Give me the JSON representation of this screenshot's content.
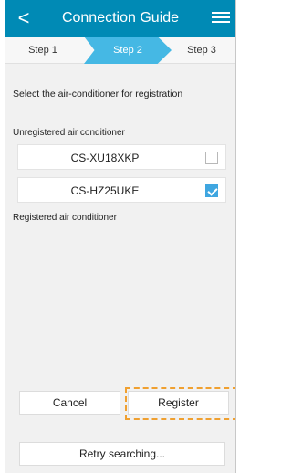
{
  "header": {
    "back_icon": "<",
    "title": "Connection Guide",
    "menu_icon": "hamburger-menu"
  },
  "steps": {
    "step1": "Step 1",
    "step2": "Step 2",
    "step3": "Step 3",
    "active": "Step 2",
    "active_color": "#45b8e4"
  },
  "instruction": "Select the air-conditioner for registration",
  "unregistered": {
    "label": "Unregistered air conditioner",
    "items": [
      {
        "name": "CS-XU18XKP",
        "checked": false
      },
      {
        "name": "CS-HZ25UKE",
        "checked": true
      }
    ]
  },
  "registered": {
    "label": "Registered air conditioner",
    "items": []
  },
  "buttons": {
    "cancel": "Cancel",
    "register": "Register",
    "retry": "Retry searching..."
  },
  "colors": {
    "header": "#008ab5",
    "checkbox_checked": "#3fa6e0",
    "highlight": "#f0a030"
  }
}
